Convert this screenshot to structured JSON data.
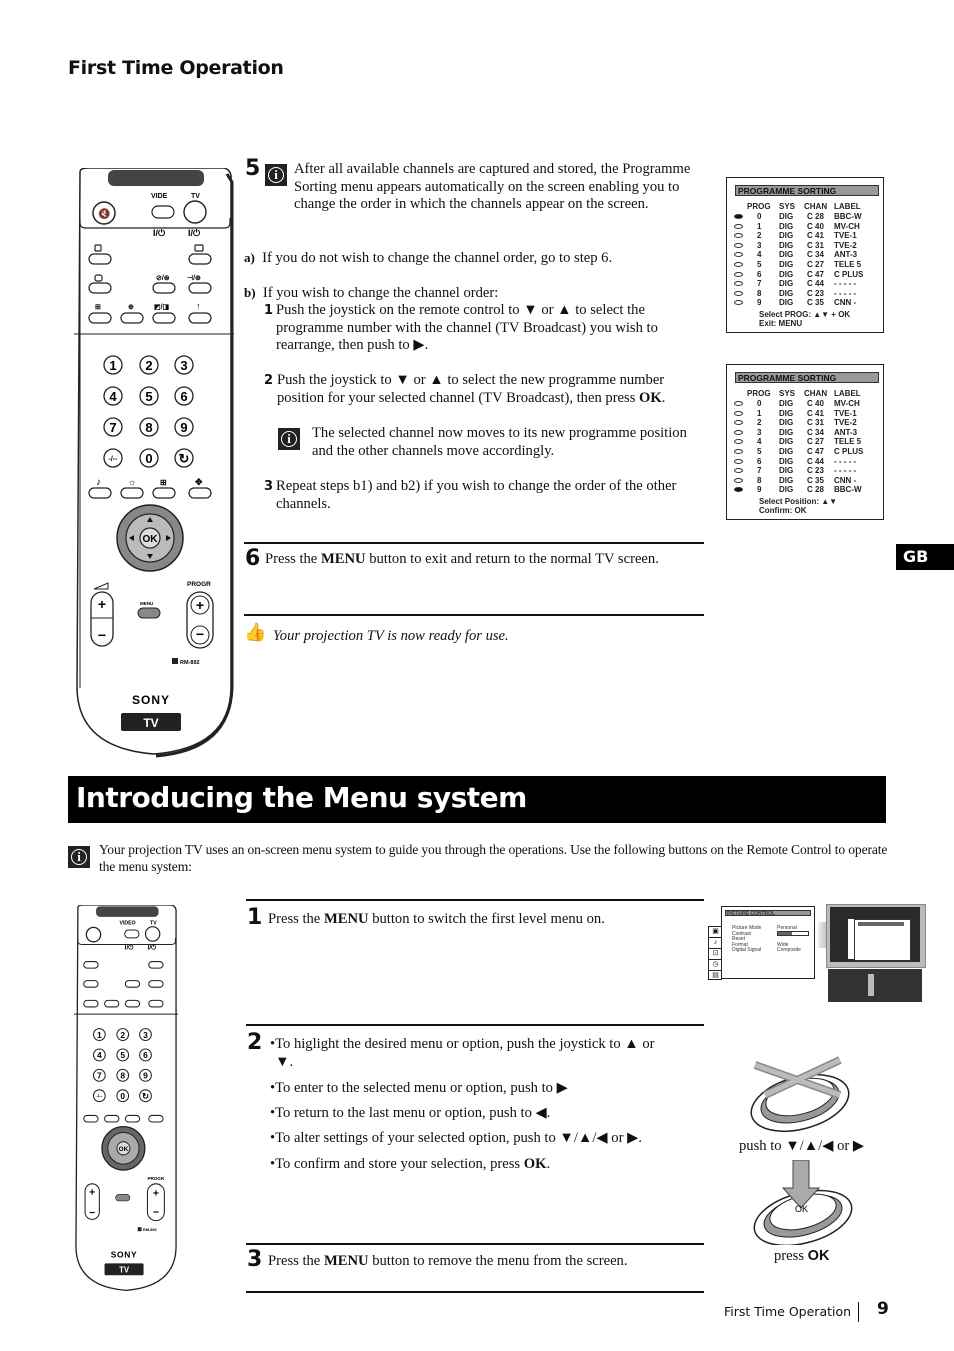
{
  "header": {
    "title": "First Time Operation"
  },
  "lang_tab": "GB",
  "step5": {
    "number": "5",
    "intro": "After all available channels are captured and stored, the Programme Sorting menu appears automatically on the screen enabling you to change the order in which the channels appear on the screen.",
    "a_label": "a)",
    "a_text": "If you do not wish to change the channel order, go to step 6.",
    "b_label": "b)",
    "b_text": "If you wish to change the channel order:",
    "b1_num": "1",
    "b1_text": "Push the joystick on the remote control to ▼ or ▲ to select the programme number with the channel (TV Broadcast) you wish to rearrange, then push to ▶.",
    "b2_num": "2",
    "b2_text_pre": "Push the joystick to ▼ or ▲ to select the new programme number position for your selected channel (TV Broadcast), then press ",
    "b2_text_bold": "OK",
    "b2_text_post": ".",
    "note": "The selected channel now moves to its new programme position and the other channels move accordingly.",
    "b3_num": "3",
    "b3_text": "Repeat steps b1) and b2) if you wish to change the order of the other channels."
  },
  "step6": {
    "number": "6",
    "pre": "Press the ",
    "bold": "MENU",
    "post": " button to exit and return to the normal TV screen."
  },
  "ready_note": "Your projection TV is now ready for use.",
  "osd1": {
    "title": "PROGRAMME  SORTING",
    "headers": [
      "PROG",
      "SYS",
      "CHAN",
      "LABEL"
    ],
    "rows": [
      {
        "selected": true,
        "prog": "0",
        "sys": "DIG",
        "chan": "C  28",
        "label": "BBC-W"
      },
      {
        "selected": false,
        "prog": "1",
        "sys": "DIG",
        "chan": "C  40",
        "label": "MV-CH"
      },
      {
        "selected": false,
        "prog": "2",
        "sys": "DIG",
        "chan": "C  41",
        "label": "TVE-1"
      },
      {
        "selected": false,
        "prog": "3",
        "sys": "DIG",
        "chan": "C  31",
        "label": "TVE-2"
      },
      {
        "selected": false,
        "prog": "4",
        "sys": "DIG",
        "chan": "C  34",
        "label": "ANT-3"
      },
      {
        "selected": false,
        "prog": "5",
        "sys": "DIG",
        "chan": "C  27",
        "label": "TELE 5"
      },
      {
        "selected": false,
        "prog": "6",
        "sys": "DIG",
        "chan": "C  47",
        "label": "C PLUS"
      },
      {
        "selected": false,
        "prog": "7",
        "sys": "DIG",
        "chan": "C  44",
        "label": "- - - - -"
      },
      {
        "selected": false,
        "prog": "8",
        "sys": "DIG",
        "chan": "C  23",
        "label": "- - - - -"
      },
      {
        "selected": false,
        "prog": "9",
        "sys": "DIG",
        "chan": "C  35",
        "label": "CNN -"
      }
    ],
    "footer1": "Select PROG:  ▲▼ + OK",
    "footer2": "Exit: MENU"
  },
  "osd2": {
    "title": "PROGRAMME  SORTING",
    "headers": [
      "PROG",
      "SYS",
      "CHAN",
      "LABEL"
    ],
    "rows": [
      {
        "selected": false,
        "prog": "0",
        "sys": "DIG",
        "chan": "C  40",
        "label": "MV-CH"
      },
      {
        "selected": false,
        "prog": "1",
        "sys": "DIG",
        "chan": "C  41",
        "label": "TVE-1"
      },
      {
        "selected": false,
        "prog": "2",
        "sys": "DIG",
        "chan": "C  31",
        "label": "TVE-2"
      },
      {
        "selected": false,
        "prog": "3",
        "sys": "DIG",
        "chan": "C  34",
        "label": "ANT-3"
      },
      {
        "selected": false,
        "prog": "4",
        "sys": "DIG",
        "chan": "C  27",
        "label": "TELE 5"
      },
      {
        "selected": false,
        "prog": "5",
        "sys": "DIG",
        "chan": "C  47",
        "label": "C PLUS"
      },
      {
        "selected": false,
        "prog": "6",
        "sys": "DIG",
        "chan": "C  44",
        "label": "- - - - -"
      },
      {
        "selected": false,
        "prog": "7",
        "sys": "DIG",
        "chan": "C  23",
        "label": "- - - - -"
      },
      {
        "selected": false,
        "prog": "8",
        "sys": "DIG",
        "chan": "C  35",
        "label": "CNN -"
      },
      {
        "selected": true,
        "prog": "9",
        "sys": "DIG",
        "chan": "C  28",
        "label": "BBC-W"
      }
    ],
    "footer1": "Select Position:  ▲▼",
    "footer2": "Confirm: OK"
  },
  "remote": {
    "video_label": "VIDE",
    "video_label_small": "VIDEO",
    "tv_label": "TV",
    "power_glyph": "I/⏻",
    "digits": [
      "1",
      "2",
      "3",
      "4",
      "5",
      "6",
      "7",
      "8",
      "9",
      "-/--",
      "0",
      "↻"
    ],
    "ok_label": "OK",
    "menu_label": "MENU",
    "progr_label": "PROGR",
    "model": "RM-892",
    "brand": "SONY",
    "tv_badge": "TV"
  },
  "section": {
    "title": "Introducing the Menu system",
    "intro": "Your projection TV uses an on-screen menu system to guide you through the operations. Use the following buttons on the Remote Control to operate the menu system:"
  },
  "menu_steps": {
    "s1_num": "1",
    "s1_pre": "Press the ",
    "s1_bold": "MENU",
    "s1_post": " button to switch the first level menu on.",
    "s2_num": "2",
    "s2_bullets": [
      "To higlight the desired menu or option, push the joystick to ▲ or ▼.",
      "To enter to the selected menu or option, push to ▶",
      "To return to the last menu or option, push to ◀.",
      "To alter settings of your selected option, push to ▼/▲/◀ or ▶."
    ],
    "s2_last_pre": "To confirm and store your selection, press ",
    "s2_last_bold": "OK",
    "s2_last_post": ".",
    "s3_num": "3",
    "s3_pre": "Press the ",
    "s3_bold": "MENU",
    "s3_post": " button to remove the menu from the screen."
  },
  "picture_control": {
    "title": "PICTURE  CONTROL",
    "items": [
      {
        "label": "Picture Mode",
        "value": "Personal"
      },
      {
        "label": "Contrast",
        "value": ""
      },
      {
        "label": "Reset",
        "value": ""
      },
      {
        "label": "Format",
        "value": "Wide"
      },
      {
        "label": "Digital Signal",
        "value": "Composite"
      }
    ],
    "contrast_level": 0.45
  },
  "joystick": {
    "push_caption": "push to ▼/▲/◀ or ▶",
    "press_pre": "press ",
    "press_bold": "OK"
  },
  "footer": {
    "label": "First Time Operation",
    "page": "9"
  }
}
